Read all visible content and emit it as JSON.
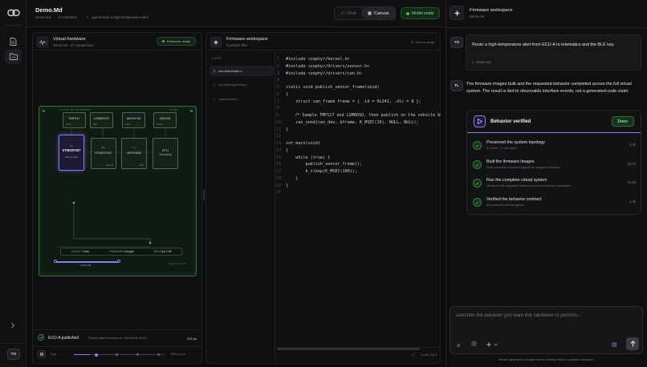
{
  "user": {
    "initials": "TG"
  },
  "assistant": {
    "initials": "TL"
  },
  "header": {
    "title": "Demo.Md",
    "meta_file": "Demo.md",
    "meta_controllers": "5 controllers",
    "meta_branch": "agent/route-a-high-temperature-alert",
    "chat_label": "Chat",
    "canvas_label": "Canvas",
    "status_label": "Model ready"
  },
  "hardware": {
    "title": "Virtual hardware",
    "subtitle": "Demo.md · 47 components",
    "badge": "Reference model",
    "board_label_left": "SIGNAL ENVIRONMENT",
    "board_label_right": "5V RAIL",
    "chips": [
      {
        "name": "TMP117",
        "sub": "Temp"
      },
      {
        "name": "LSM6DSO",
        "sub": "IMU"
      },
      {
        "name": "MAX9744",
        "sub": "Amp"
      },
      {
        "name": "INA226",
        "sub": "Power"
      },
      {
        "name": "STM32F407",
        "sub": "ECU-A main"
      },
      {
        "name": "STM32F407",
        "sub": "ECU-B"
      },
      {
        "name": "nRF52840",
        "sub": "BLE"
      },
      {
        "name": "ETH",
        "sub": "Telemetry"
      }
    ],
    "chip_index_a": "A1",
    "chip_index_b": "B1",
    "chip_index_c": "C1",
    "stats": [
      {
        "label": "CAN/I2C",
        "value": "7 links"
      },
      {
        "label": "FIRMWARE",
        "value": "3 images"
      },
      {
        "label": "BUS",
        "value": "CAN 2.0B"
      }
    ],
    "scrub_label": "CAN 2.0B",
    "board_footer": "SIGNAL PATH MAP",
    "event_title": "ECU-A published",
    "event_desc": "Sensor state encoded as CAN frame 0x241",
    "event_time": "318 µs",
    "timeline_start": "0 µs",
    "timeline_end": "1000 µs 1x",
    "timeline_progress": 0.18
  },
  "firmware": {
    "title": "Firmware workspace",
    "subtitle": "3 product files",
    "sync": "Source ready",
    "files_header": "FILES",
    "files": [
      {
        "name": "ecu-a/src/main.c",
        "active": true
      },
      {
        "name": "ecu-b/src/gateway.c",
        "active": false
      },
      {
        "name": "radio/src/ble.c",
        "active": false
      }
    ],
    "code": [
      "#include <zephyr/kernel.h>",
      "#include <zephyr/drivers/sensor.h>",
      "#include <zephyr/drivers/can.h>",
      "",
      "static void publish_sensor_frame(void)",
      "{",
      "    struct can_frame frame = { .id = 0x241, .dlc = 8 };",
      "",
      "    /* Sample TMP117 and LSM6DSO, then publish on the vehicle bus. */",
      "    can_send(can_dev, &frame, K_MSEC(10), NULL, NULL);",
      "}",
      "",
      "int main(void)",
      "{",
      "    while (true) {",
      "        publish_sensor_frame();",
      "        k_sleep(K_MSEC(100));",
      "    }",
      "}",
      ""
    ],
    "status_lang": "C",
    "status_pos": "Ln 49, Col 6"
  },
  "chat": {
    "title": "Firmware workspace",
    "subtitle": "Demo.md",
    "user_message": "Route a high-temperature alert from ECU-A to telematics and the BLE key.",
    "attachment": "Demo.md",
    "assistant_message": "The firmware images built and the requested behavior completed across the full virtual system. The result is tied to observable interface events, not a generated-code claim.",
    "card_title": "Behavior verified",
    "card_status": "Done",
    "steps": [
      {
        "title": "Preserved the system topology",
        "sub": "47 parts · 5 controllers",
        "time": "2.4s"
      },
      {
        "title": "Built the firmware images",
        "sub": "Each controller compiled against its mapped interfaces",
        "time": "18.7s"
      },
      {
        "title": "Ran the complete virtual system",
        "sub": "Observed the requested behavior across controller boundaries",
        "time": "24.8s"
      },
      {
        "title": "Verified the behavior contract",
        "sub": "All protected checks passed",
        "time": "1.3s"
      }
    ],
    "input_placeholder": "Describe the behavior you want this hardware to perform...",
    "footer": "Review generated changes before running them on physical hardware."
  },
  "colors": {
    "accent_green": "#3fb950",
    "accent_purple": "#8b7cf6",
    "chip_green": "#4c6b4e"
  }
}
